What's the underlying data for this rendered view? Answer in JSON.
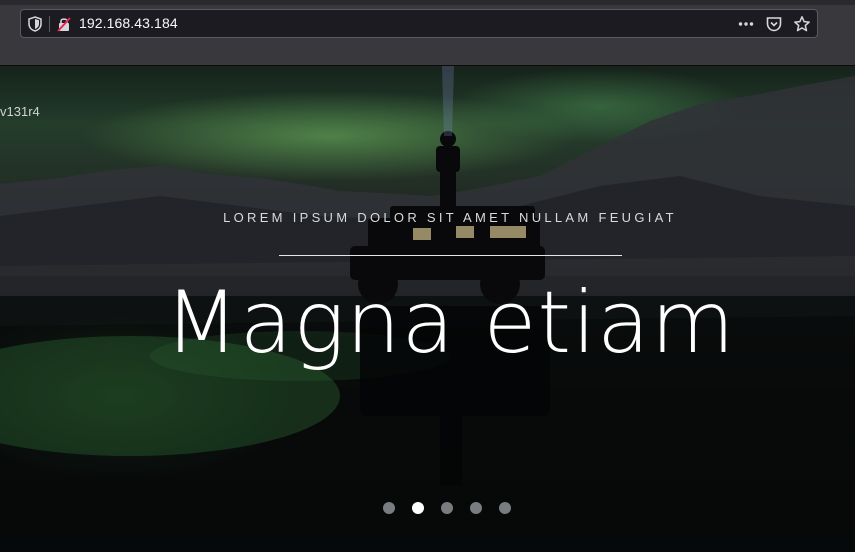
{
  "browser": {
    "url": "192.168.43.184",
    "icons": [
      "shield-icon",
      "insecure-lock-icon",
      "more-actions-icon",
      "pocket-icon",
      "bookmark-star-icon"
    ]
  },
  "hero": {
    "logo_text": "v131r4",
    "tagline": "LOREM IPSUM DOLOR SIT AMET NULLAM FEUGIAT",
    "headline": "Magna etiam",
    "slides": {
      "count": 5,
      "active_index": 1
    }
  },
  "colors": {
    "chrome_bg": "#38383d",
    "urlbar_bg": "#1c1b22",
    "headline": "#ffffff",
    "dot_inactive": "#7a7d7f",
    "dot_active": "#ffffff"
  }
}
